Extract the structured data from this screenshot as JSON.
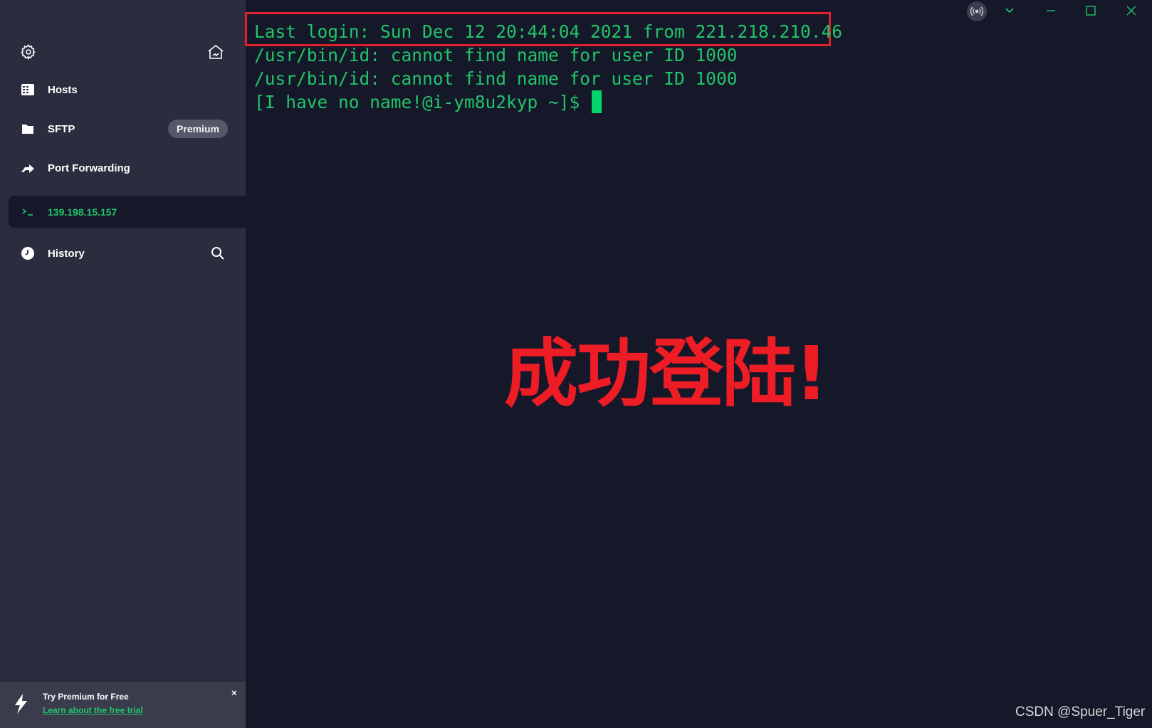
{
  "sidebar": {
    "items": [
      {
        "label": "Hosts",
        "icon": "hosts-icon"
      },
      {
        "label": "SFTP",
        "icon": "folder-icon",
        "badge": "Premium"
      },
      {
        "label": "Port Forwarding",
        "icon": "port-forwarding-icon"
      },
      {
        "label": "139.198.15.157",
        "icon": "terminal-icon",
        "active": true
      },
      {
        "label": "History",
        "icon": "history-icon"
      }
    ],
    "promo": {
      "title": "Try Premium for Free",
      "link": "Learn about the free trial",
      "close": "×"
    }
  },
  "terminal": {
    "lines": [
      "Last login: Sun Dec 12 20:44:04 2021 from 221.218.210.46",
      "/usr/bin/id: cannot find name for user ID 1000",
      "/usr/bin/id: cannot find name for user ID 1000",
      "[I have no name!@i-ym8u2kyp ~]$ "
    ]
  },
  "overlay": {
    "caption": "成功登陆!"
  },
  "watermark": "CSDN @Spuer_Tiger",
  "colors": {
    "sidebar_bg": "#2b2d3e",
    "terminal_bg": "#151829",
    "accent_green": "#21c46b",
    "annotation_red": "#e0202a"
  }
}
